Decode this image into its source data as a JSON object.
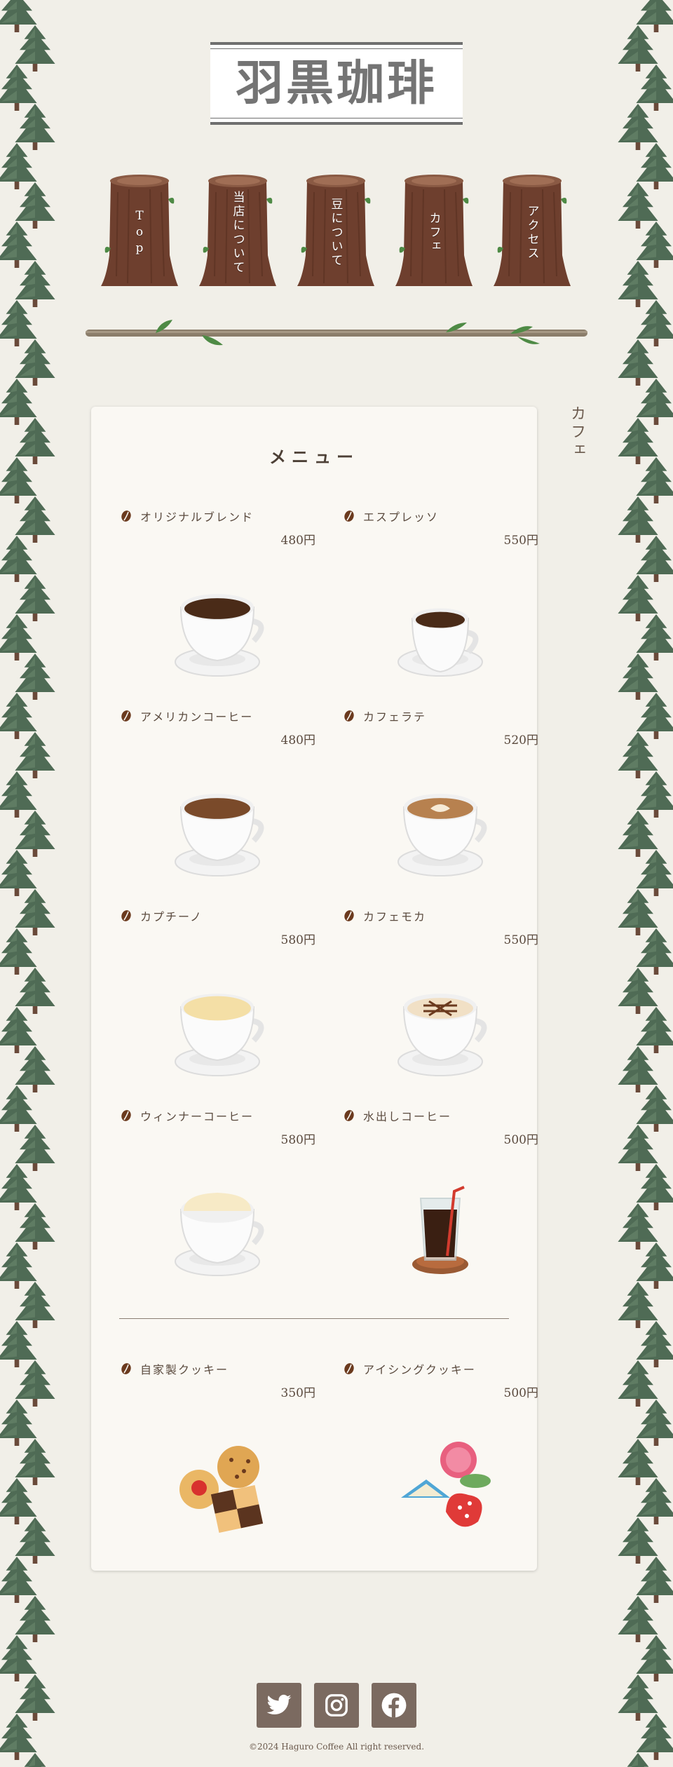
{
  "site": {
    "logo_text": "羽黒珈琲"
  },
  "nav": {
    "items": [
      {
        "label": "Top"
      },
      {
        "label": "当店について"
      },
      {
        "label": "豆について"
      },
      {
        "label": "カフェ"
      },
      {
        "label": "アクセス"
      }
    ]
  },
  "section": {
    "side_label": "カフェ"
  },
  "menu": {
    "title": "メニュー",
    "drinks": [
      {
        "name": "オリジナルブレンド",
        "price": "480円",
        "icon": "coffee-cup-icon"
      },
      {
        "name": "エスプレッソ",
        "price": "550円",
        "icon": "espresso-cup-icon"
      },
      {
        "name": "アメリカンコーヒー",
        "price": "480円",
        "icon": "american-coffee-icon"
      },
      {
        "name": "カフェラテ",
        "price": "520円",
        "icon": "latte-art-icon"
      },
      {
        "name": "カプチーノ",
        "price": "580円",
        "icon": "cappuccino-icon"
      },
      {
        "name": "カフェモカ",
        "price": "550円",
        "icon": "cafe-mocha-icon"
      },
      {
        "name": "ウィンナーコーヒー",
        "price": "580円",
        "icon": "vienna-coffee-icon"
      },
      {
        "name": "水出しコーヒー",
        "price": "500円",
        "icon": "iced-coffee-icon"
      }
    ],
    "sweets": [
      {
        "name": "自家製クッキー",
        "price": "350円",
        "icon": "homemade-cookies-icon"
      },
      {
        "name": "アイシングクッキー",
        "price": "500円",
        "icon": "icing-cookies-icon"
      }
    ]
  },
  "footer": {
    "social": [
      {
        "icon": "twitter-icon"
      },
      {
        "icon": "instagram-icon"
      },
      {
        "icon": "facebook-icon"
      }
    ],
    "copyright": "©2024 Haguro Coffee All right reserved."
  },
  "colors": {
    "background": "#f1efe8",
    "card": "#faf8f3",
    "stump": "#6e3f2e",
    "tree": "#4f6b55",
    "social_button": "#7b6a60"
  }
}
